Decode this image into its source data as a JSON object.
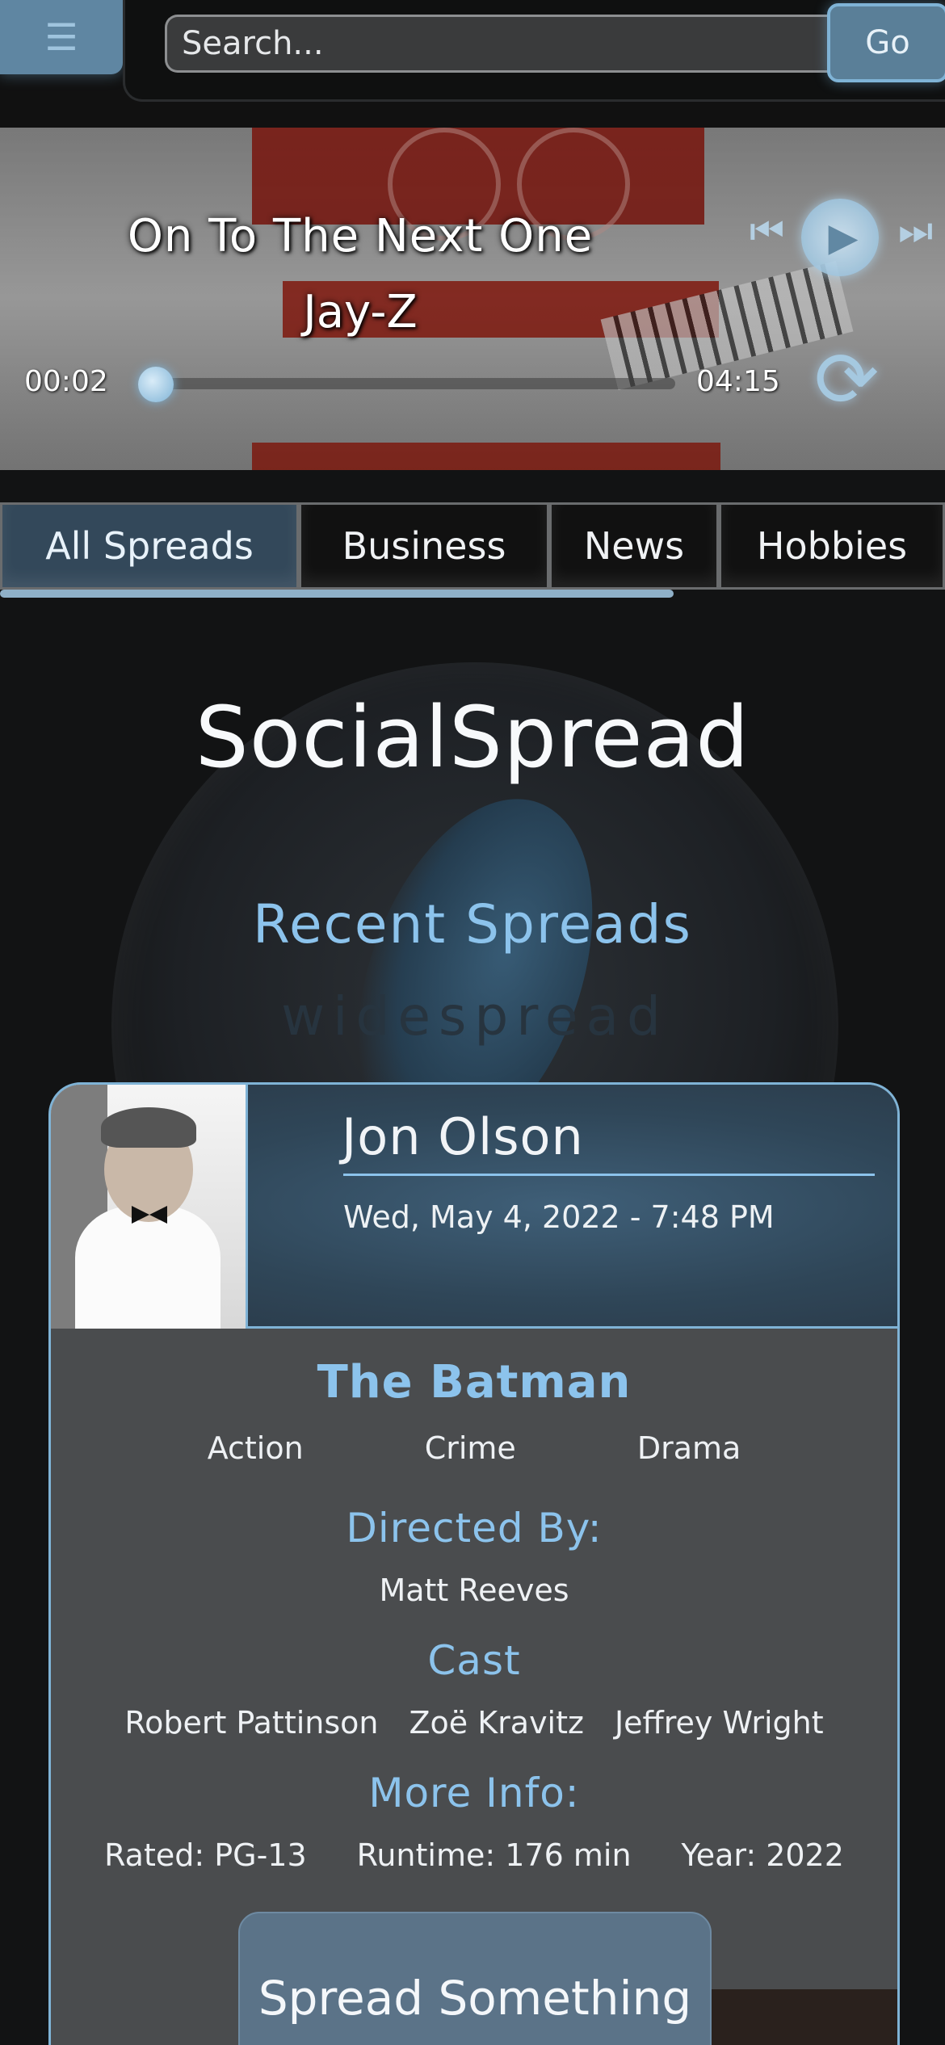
{
  "header": {
    "menu_icon": "hamburger-icon",
    "search": {
      "placeholder": "Search...",
      "value": ""
    },
    "go_label": "Go"
  },
  "player": {
    "song_title": "On To The Next One",
    "artist": "Jay-Z",
    "current_time": "00:02",
    "total_time": "04:15",
    "progress_fraction": 0.008,
    "icons": [
      "previous-icon",
      "play-icon",
      "next-icon",
      "repeat-icon"
    ]
  },
  "tabs": [
    {
      "label": "All Spreads",
      "active": true
    },
    {
      "label": "Business",
      "active": false
    },
    {
      "label": "News",
      "active": false
    },
    {
      "label": "Hobbies",
      "active": false
    }
  ],
  "main": {
    "site_title": "SocialSpread",
    "section_title": "Recent Spreads",
    "watermark_word": "widespread"
  },
  "post": {
    "user_name": "Jon Olson",
    "date": "Wed, May 4, 2022 - 7:48 PM",
    "movie_title": "The Batman",
    "genres": [
      "Action",
      "Crime",
      "Drama"
    ],
    "directed_by_label": "Directed By:",
    "director": "Matt Reeves",
    "cast_label": "Cast",
    "cast": [
      "Robert Pattinson",
      "Zoë Kravitz",
      "Jeffrey Wright"
    ],
    "more_info_label": "More Info:",
    "rated": "Rated: PG-13",
    "runtime": "Runtime: 176 min",
    "year": "Year: 2022"
  },
  "spread_button_label": "Spread Something",
  "colors": {
    "accent": "#8cc3ec",
    "button": "#5a7f98",
    "background": "#121314"
  }
}
